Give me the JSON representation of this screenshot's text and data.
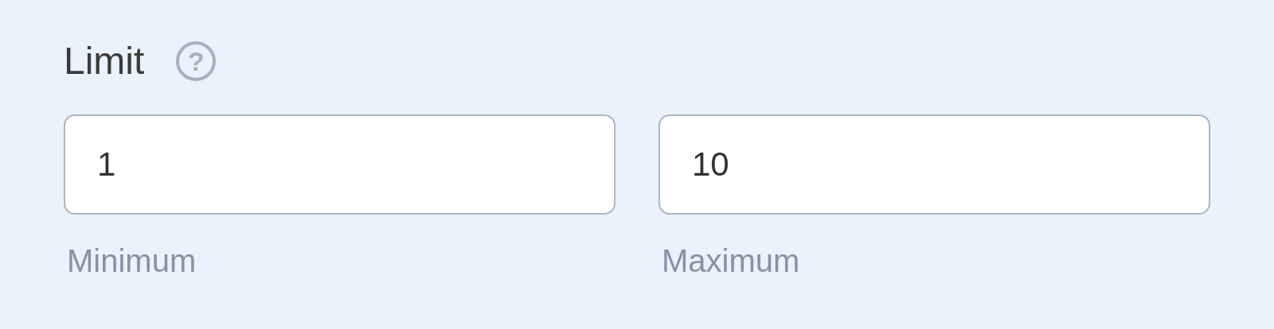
{
  "field": {
    "label": "Limit",
    "help": "?"
  },
  "inputs": [
    {
      "value": "1",
      "sublabel": "Minimum"
    },
    {
      "value": "10",
      "sublabel": "Maximum"
    }
  ]
}
